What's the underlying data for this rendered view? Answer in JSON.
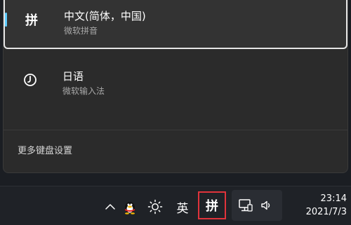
{
  "ime_flyout": {
    "items": [
      {
        "badge": "拼",
        "name": "中文(简体，中国)",
        "subtitle": "微软拼音",
        "selected": true
      },
      {
        "icon": "japanese-ime-icon",
        "name": "日语",
        "subtitle": "微软输入法",
        "selected": false
      }
    ],
    "more_settings_label": "更多键盘设置"
  },
  "taskbar": {
    "tray": {
      "chevron_icon": "chevron-up-icon",
      "qq_icon": "qq-penguin-icon",
      "brightness_icon": "sun-icon",
      "language_label": "英",
      "ime_label": "拼",
      "network_icon": "network-icon",
      "volume_icon": "speaker-icon"
    },
    "clock": {
      "time": "23:14",
      "date": "2021/7/3"
    }
  },
  "colors": {
    "accent": "#60cdff",
    "highlight_box": "#e0333b",
    "flyout_bg": "#2b2b2b",
    "taskbar_bg": "#1f2227"
  }
}
